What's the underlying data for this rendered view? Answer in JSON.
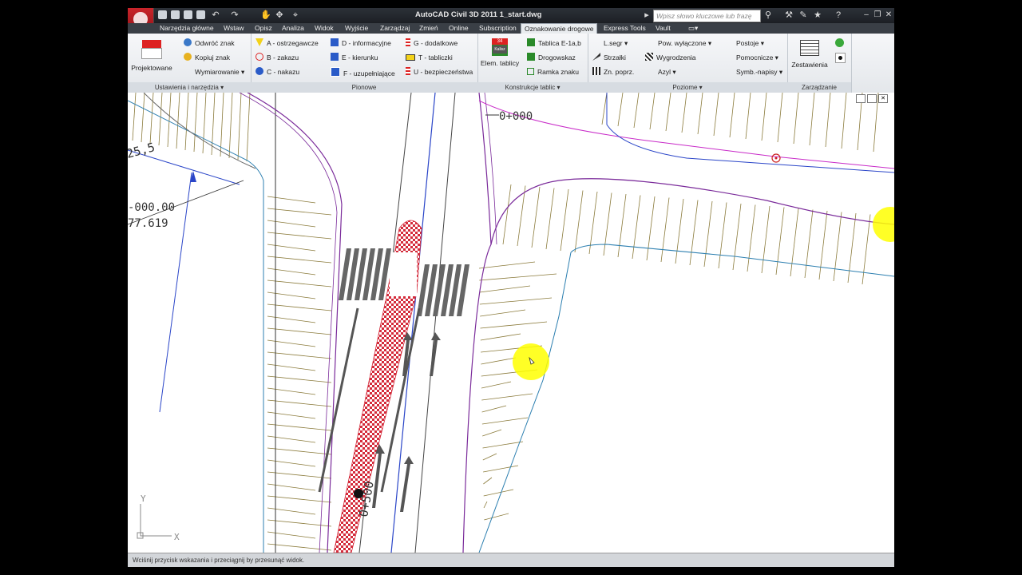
{
  "window": {
    "title": "AutoCAD Civil 3D 2011    1_start.dwg",
    "search_placeholder": "Wpisz słowo kluczowe lub frazę"
  },
  "tabs": [
    {
      "label": "Narzędzia główne"
    },
    {
      "label": "Wstaw"
    },
    {
      "label": "Opisz"
    },
    {
      "label": "Analiza"
    },
    {
      "label": "Widok"
    },
    {
      "label": "Wyjście"
    },
    {
      "label": "Zarządzaj"
    },
    {
      "label": "Zmień"
    },
    {
      "label": "Online"
    },
    {
      "label": "Subscription"
    },
    {
      "label": "Oznakowanie drogowe",
      "active": true
    },
    {
      "label": "Express Tools"
    },
    {
      "label": "Vault"
    }
  ],
  "ribbon": {
    "ustawienia": {
      "title": "Ustawienia i narzędzia",
      "projektowane": "Projektowane",
      "odwroc": "Odwróć znak",
      "kopiuj": "Kopiuj znak",
      "wymiarowanie": "Wymiarowanie"
    },
    "pionowe": {
      "title": "Pionowe",
      "a": "A - ostrzegawcze",
      "b": "B - zakazu",
      "c": "C - nakazu",
      "d": "D - informacyjne",
      "e": "E - kierunku",
      "f": "F - uzupełniające",
      "g": "G - dodatkowe",
      "t": "T - tabliczki",
      "u": "U - bezpieczeństwa"
    },
    "konstrukcje": {
      "title": "Konstrukcje tablic",
      "elem": "Elem. tablicy",
      "tablica": "Tablica E-1a,b",
      "drogowskaz": "Drogowskaz",
      "ramka": "Ramka znaku",
      "sign_num": "34",
      "sign_text": "Kalisz"
    },
    "poziome": {
      "title": "Poziome",
      "lsegr": "L.segr",
      "strzalki": "Strzałki",
      "znpoprz": "Zn. poprz.",
      "pow": "Pow. wyłączone",
      "wygrodzenia": "Wygrodzenia",
      "azyl": "Azyl",
      "postoje": "Postoje",
      "pomocnicze": "Pomocnicze",
      "symb": "Symb.-napisy"
    },
    "zarzadzanie": {
      "title": "Zarządzanie",
      "zestawienia": "Zestawienia"
    }
  },
  "drawing": {
    "station_top": "0+000",
    "station_mid": "0+500",
    "label_255": "25,5",
    "label_000": "-000.00",
    "label_77": "77.619",
    "axis_y": "Y",
    "axis_x": "X",
    "colors": {
      "road": "#2a45c8",
      "edge": "#6a1a8a",
      "hatch": "#d42a3a",
      "paint": "#555555",
      "highlight": "#ffff00"
    }
  },
  "status": {
    "prompt": "Wciśnij przycisk wskazania i przeciągnij by przesunąć widok."
  }
}
